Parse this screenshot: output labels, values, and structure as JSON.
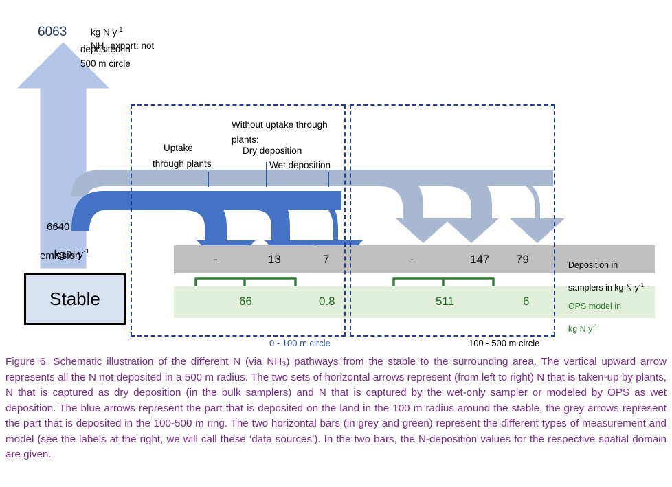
{
  "figure": {
    "vertical_arrow": {
      "value": "6063",
      "unit_line": "kg N y",
      "unit_exp": "-1",
      "description_line1": "NH",
      "description_sub": "3",
      "description_line1b": " export: not",
      "description_line2": "deposited in",
      "description_line3": "500 m circle"
    },
    "emission": {
      "value": "6640",
      "unit": "kg N y",
      "unit_exp": "-1",
      "label": "emission"
    },
    "stable_box": {
      "label": "Stable"
    },
    "pathway_labels": {
      "uptake_line1": "Uptake",
      "uptake_line2": "through plants",
      "without_uptake_line1": "Without uptake through",
      "without_uptake_line2": "plants:",
      "dry_deposition": "Dry deposition",
      "wet_deposition": "Wet deposition"
    },
    "zones": {
      "inner_label": "0 - 100 m circle",
      "outer_label": "100 - 500 m circle"
    },
    "row_labels": {
      "grey_line1": "Deposition in",
      "grey_line2": "samplers in kg N y",
      "grey_line2_exp": "-1",
      "green_line1": "OPS model in",
      "green_line2": "kg N y",
      "green_line2_exp": "-1"
    },
    "colors": {
      "blue_arrow": "#4472C4",
      "grey_arrow": "#A9B8D1",
      "vertical_arrow": "#B4C6E7",
      "grey_bar": "#BFBFBF",
      "green_bar": "#E2EFDA",
      "green_text": "#1F6A1F",
      "dash_border": "#1F3E8C",
      "caption_text": "#7B2C8C",
      "number_blue": "#1F3864"
    }
  },
  "chart_data": {
    "type": "table",
    "title": "Schematic of N (via NH3) pathways from the stable to the surrounding area",
    "categories": [
      "Uptake through plants",
      "Dry deposition",
      "Wet deposition"
    ],
    "domains": [
      "0 - 100 m circle",
      "100 - 500 m circle"
    ],
    "series": [
      {
        "name": "Deposition in samplers in kg N y-1",
        "domain": "0 - 100 m circle",
        "values": [
          "-",
          "13",
          "7"
        ]
      },
      {
        "name": "Deposition in samplers in kg N y-1",
        "domain": "100 - 500 m circle",
        "values": [
          "-",
          "147",
          "79"
        ]
      },
      {
        "name": "OPS model in kg N y-1",
        "domain": "0 - 100 m circle",
        "values": [
          "66",
          "0.8"
        ],
        "value_spans": [
          "uptake+dry",
          "wet"
        ]
      },
      {
        "name": "OPS model in kg N y-1",
        "domain": "100 - 500 m circle",
        "values": [
          "511",
          "6"
        ],
        "value_spans": [
          "uptake+dry",
          "wet"
        ]
      }
    ],
    "totals": {
      "emission": 6640,
      "export_not_deposited_500m": 6063
    },
    "units": "kg N y-1"
  },
  "values": {
    "grey_inner_1": "-",
    "grey_inner_2": "13",
    "grey_inner_3": "7",
    "grey_outer_1": "-",
    "grey_outer_2": "147",
    "grey_outer_3": "79",
    "green_inner_1": "66",
    "green_inner_2": "0.8",
    "green_outer_1": "511",
    "green_outer_2": "6"
  },
  "caption": {
    "text": "Figure 6. Schematic illustration of the different N (via NH₃) pathways from the stable to the surrounding area. The vertical upward arrow represents all the N not deposited in a 500 m radius. The two sets of horizontal arrows represent (from left to right) N that is taken-up by plants, N that is captured as dry deposition (in the bulk samplers) and N that is captured by the wet-only sampler or modeled by OPS as wet deposition. The blue arrows represent the part that is deposited on the land in the 100 m radius around the stable, the grey arrows represent the part that is deposited in the 100-500 m ring. The two horizontal bars (in grey and green) represent the different types of measurement and model (see the labels at the right, we will call these ‘data sources’). In the two bars, the N-deposition values for the respective spatial domain are given."
  }
}
